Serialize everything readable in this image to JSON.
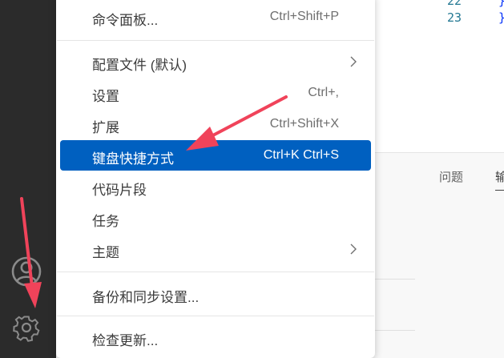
{
  "editor": {
    "line_numbers": [
      "22",
      "23"
    ],
    "braces": [
      "}",
      "}"
    ]
  },
  "panel": {
    "tabs": [
      "问题",
      "输"
    ]
  },
  "menu": {
    "items": [
      {
        "label": "命令面板...",
        "shortcut": "Ctrl+Shift+P"
      },
      {
        "label": "配置文件 (默认)",
        "shortcut": ""
      },
      {
        "label": "设置",
        "shortcut": "Ctrl+,"
      },
      {
        "label": "扩展",
        "shortcut": "Ctrl+Shift+X"
      },
      {
        "label": "键盘快捷方式",
        "shortcut": "Ctrl+K Ctrl+S"
      },
      {
        "label": "代码片段",
        "shortcut": ""
      },
      {
        "label": "任务",
        "shortcut": ""
      },
      {
        "label": "主题",
        "shortcut": ""
      },
      {
        "label": "备份和同步设置...",
        "shortcut": ""
      },
      {
        "label": "检查更新...",
        "shortcut": ""
      }
    ],
    "highlighted_index": 4
  },
  "colors": {
    "highlight": "#0060c0",
    "annotation_arrow": "#f0435a",
    "activity_bar": "#2b2b2b"
  },
  "icons": {
    "account": "account-icon",
    "manage": "gear-icon",
    "submenu": "chevron-right-icon"
  }
}
